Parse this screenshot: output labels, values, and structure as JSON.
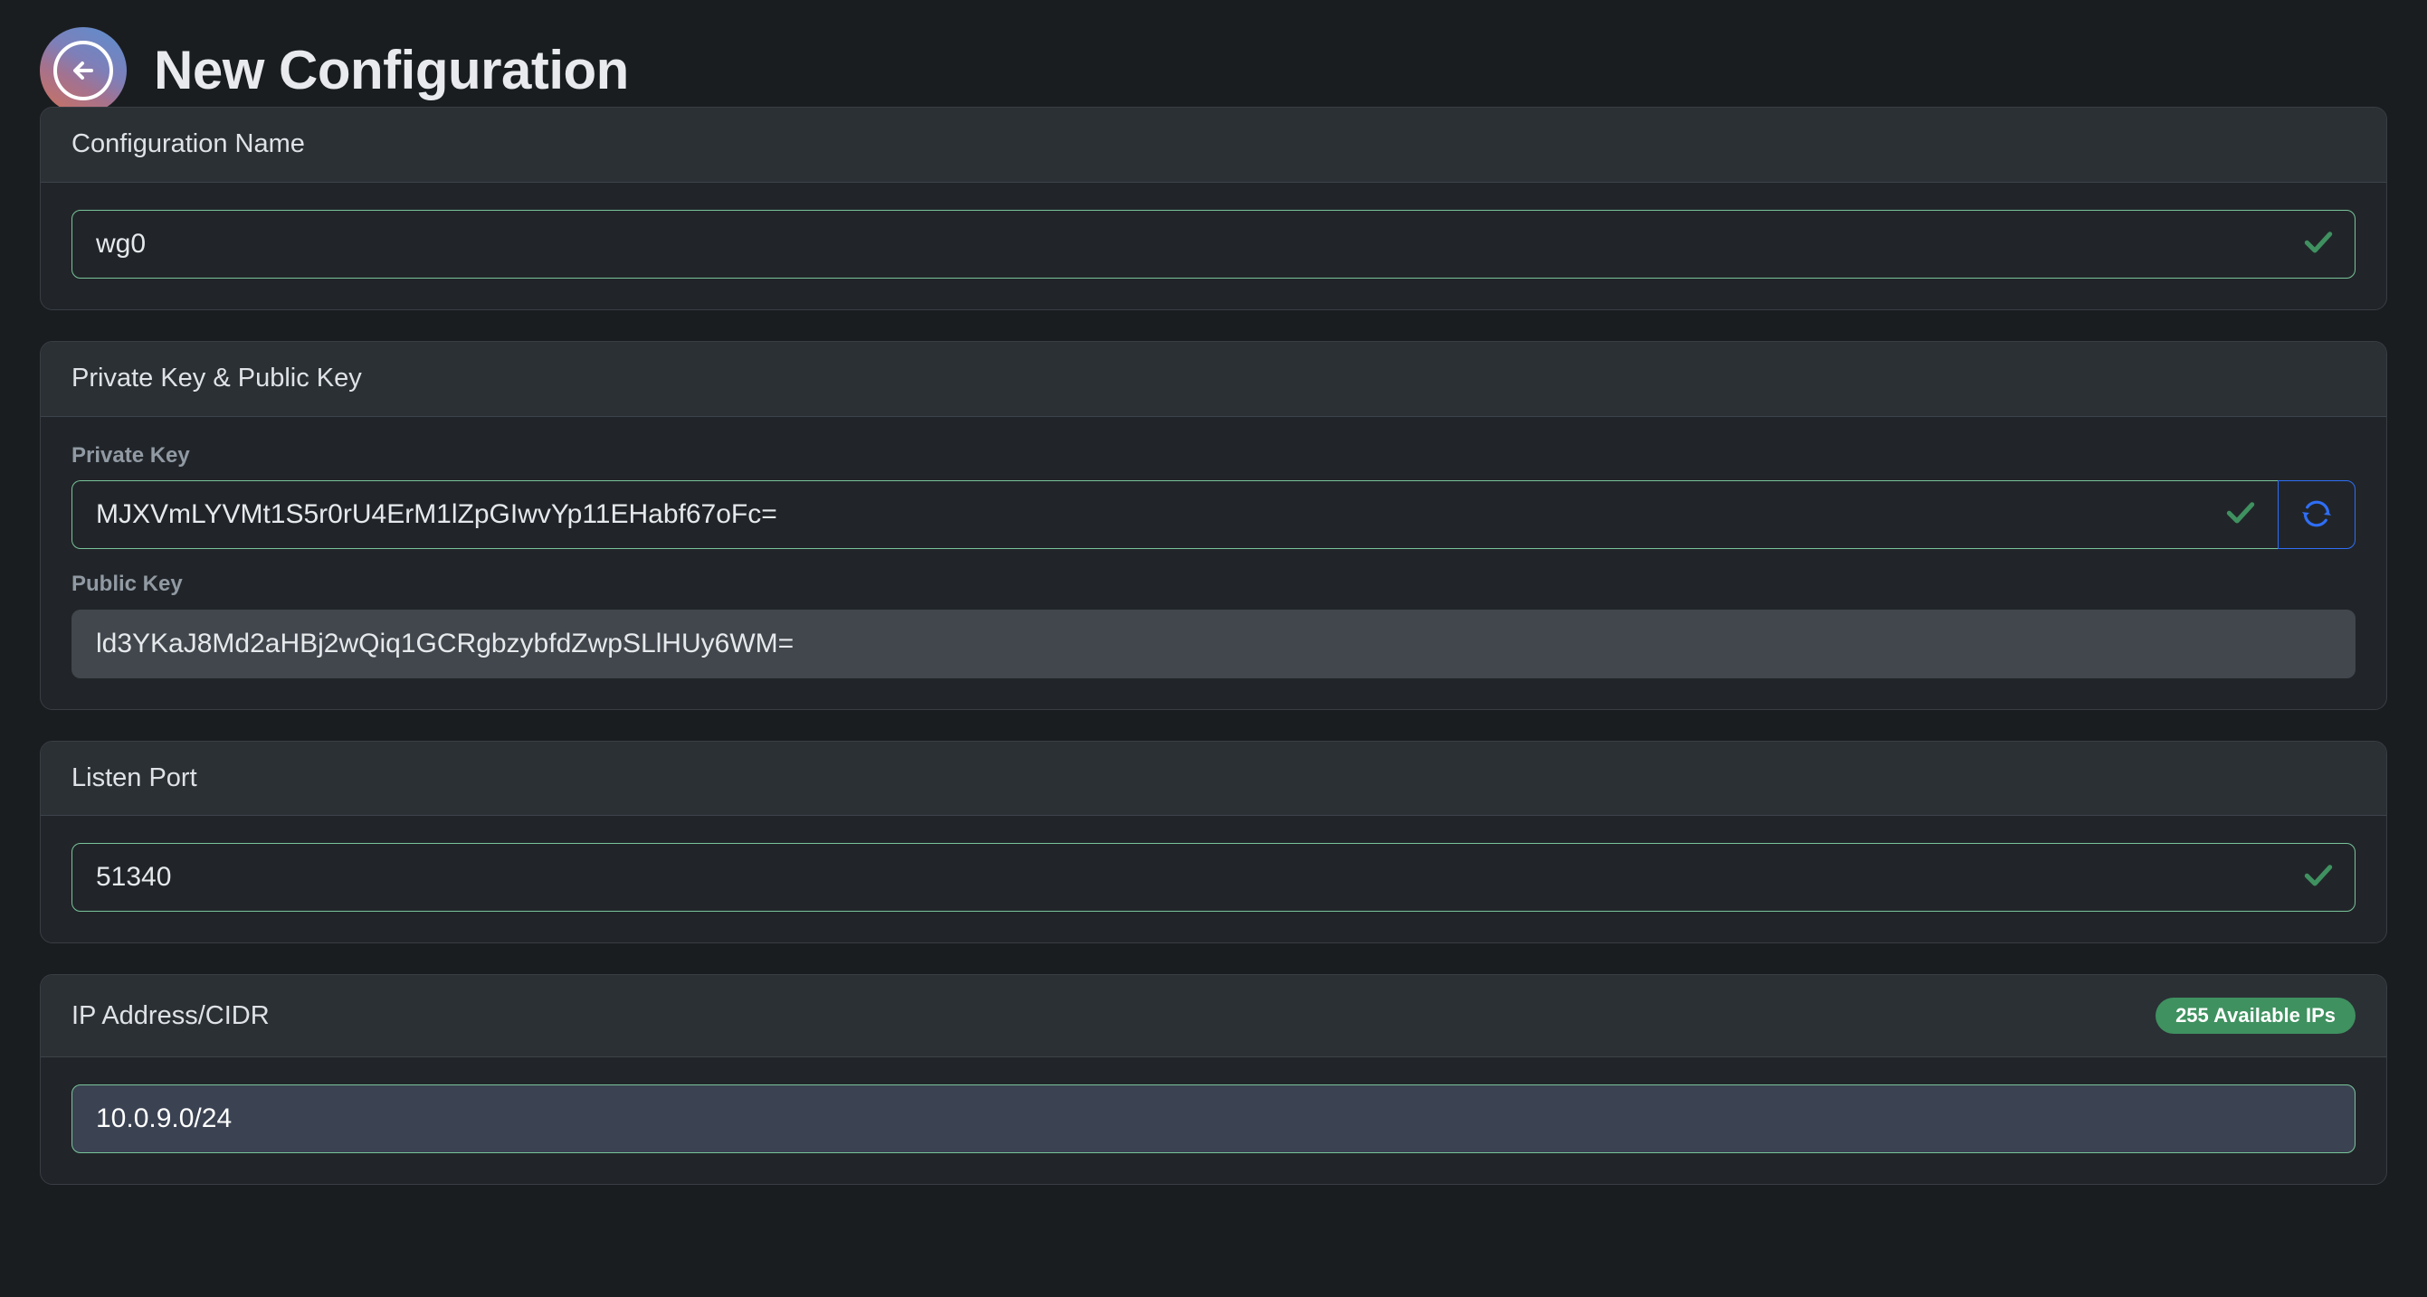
{
  "header": {
    "back_icon": "arrow-left-icon",
    "title": "New Configuration"
  },
  "cards": [
    {
      "id": "configuration-name",
      "title": "Configuration Name",
      "input": {
        "value": "wg0",
        "placeholder": "Configuration Name",
        "valid_icon": "check-icon"
      }
    },
    {
      "id": "keys",
      "title": "Private Key & Public Key",
      "private_key": {
        "label": "Private Key",
        "value": "MJXVmLYVMt1S5r0rU4ErM1lZpGIwvYp11EHabf67oFc=",
        "placeholder": "Private Key",
        "valid_icon": "check-icon",
        "refresh_icon": "refresh-icon"
      },
      "public_key": {
        "label": "Public Key",
        "value": "ld3YKaJ8Md2aHBj2wQiq1GCRgbzybfdZwpSLlHUy6WM=",
        "placeholder": "Public Key"
      }
    },
    {
      "id": "listen-port",
      "title": "Listen Port",
      "input": {
        "value": "51340",
        "placeholder": "Listen Port",
        "valid_icon": "check-icon"
      }
    },
    {
      "id": "ip-address-cidr",
      "title": "IP Address/CIDR",
      "badge": "255 Available IPs",
      "input": {
        "value": "10.0.9.0/24",
        "placeholder": "IP Address/CIDR"
      }
    }
  ],
  "colors": {
    "page_background": "#1a1d20",
    "card_background": "#212529",
    "card_header_background": "#2b3035",
    "card_border": "#383e44",
    "input_valid_border": "#79c49a",
    "check_green": "#3f9160",
    "badge_green": "#3f9160",
    "refresh_blue": "#2f6ef5",
    "input_highlight_background": "#3b4252",
    "readonly_background": "#41474d",
    "title_text": "#e8eaed",
    "label_text": "#919aa3"
  }
}
